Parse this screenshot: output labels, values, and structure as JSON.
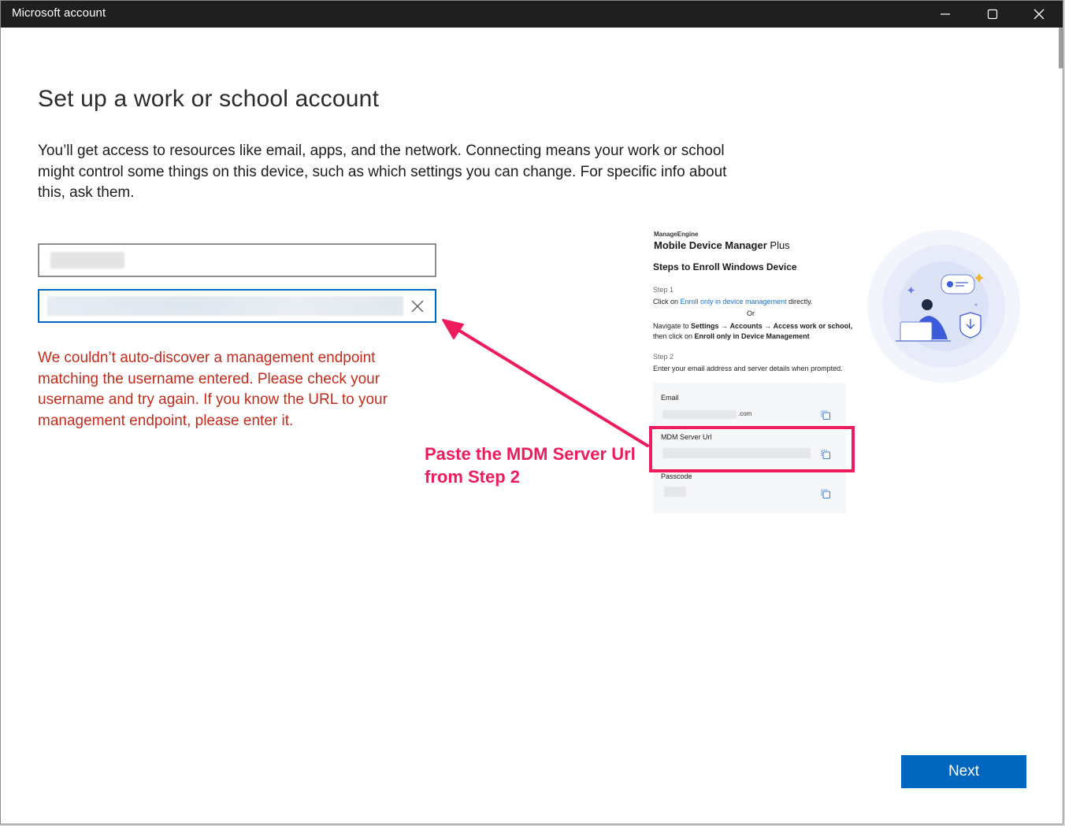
{
  "window": {
    "title": "Microsoft account"
  },
  "page": {
    "heading": "Set up a work or school account",
    "description": "You’ll get access to resources like email, apps, and the network. Connecting means your work or school might control some things on this device, such as which settings you can change. For specific info about this, ask them.",
    "error": "We couldn’t auto-discover a management endpoint matching the username entered. Please check your username and try again. If you know the URL to your management endpoint, please enter it.",
    "next_label": "Next"
  },
  "annotation": {
    "text": "Paste the MDM Server Url from Step 2",
    "color": "#ee1c5c"
  },
  "enroll_card": {
    "brand": "ManageEngine",
    "product_bold": "Mobile Device Manager",
    "product_suffix": " Plus",
    "title": "Steps to Enroll Windows Device",
    "step1_label": "Step 1",
    "step1_click": "Click on ",
    "step1_link": "Enroll only in device management",
    "step1_after": " directly.",
    "or": "Or",
    "navigate_pre": "Navigate to ",
    "nav_settings": "Settings",
    "nav_arrow": " → ",
    "nav_accounts": "Accounts",
    "nav_access": "Access work or school,",
    "then_click": "then click on ",
    "enroll_only": "Enroll only in Device Management",
    "step2_label": "Step 2",
    "step2_text": "Enter your email address and server details when prompted.",
    "email_label": "Email",
    "email_suffix": ".com",
    "server_label": "MDM Server Url",
    "passcode_label": "Passcode"
  },
  "colors": {
    "accent": "#0067c0",
    "error": "#c42b1c",
    "titlebar": "#1f1f1f"
  },
  "icons": {
    "minimize": "minimize-icon",
    "maximize": "maximize-icon",
    "close": "close-icon",
    "clear": "clear-icon",
    "copy": "copy-icon"
  }
}
